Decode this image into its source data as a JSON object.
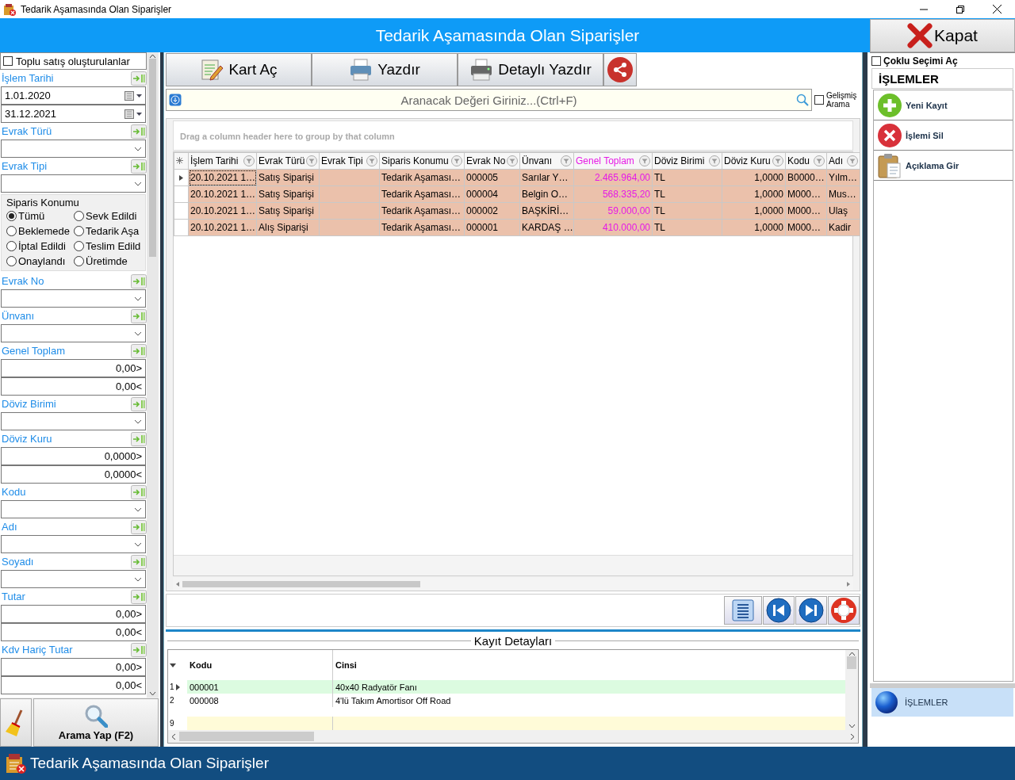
{
  "window": {
    "title": "Tedarik Aşamasında Olan Siparişler"
  },
  "header": {
    "title": "Tedarik Aşamasında Olan Siparişler",
    "close_button": "Kapat"
  },
  "filters": [
    {
      "kind": "check",
      "label": "Toplu satış oluşturulanlar",
      "checked": false
    },
    {
      "kind": "field",
      "label": "İşlem Tarihi",
      "inputs": [
        {
          "kind": "date",
          "value": "1.01.2020"
        },
        {
          "kind": "date",
          "value": "31.12.2021"
        }
      ]
    },
    {
      "kind": "field",
      "label": "Evrak Türü",
      "inputs": [
        {
          "kind": "combo"
        }
      ]
    },
    {
      "kind": "field",
      "label": "Evrak Tipi",
      "inputs": [
        {
          "kind": "combo"
        }
      ]
    },
    {
      "kind": "radios",
      "label": "Siparis Konumu",
      "options": [
        {
          "label": "Tümü",
          "selected": true
        },
        {
          "label": "Sevk Edildi",
          "selected": false
        },
        {
          "label": "Beklemede",
          "selected": false
        },
        {
          "label": "Tedarik Aşa",
          "selected": false
        },
        {
          "label": "İptal Edildi",
          "selected": false
        },
        {
          "label": "Teslim Edild",
          "selected": false
        },
        {
          "label": "Onaylandı",
          "selected": false
        },
        {
          "label": "Üretimde",
          "selected": false
        }
      ]
    },
    {
      "kind": "field",
      "label": "Evrak No",
      "inputs": [
        {
          "kind": "combo"
        }
      ]
    },
    {
      "kind": "field",
      "label": "Ünvanı",
      "inputs": [
        {
          "kind": "combo"
        }
      ]
    },
    {
      "kind": "field",
      "label": "Genel Toplam",
      "inputs": [
        {
          "kind": "number",
          "value": "0,00>"
        },
        {
          "kind": "number",
          "value": "0,00<"
        }
      ]
    },
    {
      "kind": "field",
      "label": "Döviz Birimi",
      "inputs": [
        {
          "kind": "combo"
        }
      ]
    },
    {
      "kind": "field",
      "label": "Döviz Kuru",
      "inputs": [
        {
          "kind": "number",
          "value": "0,0000>"
        },
        {
          "kind": "number",
          "value": "0,0000<"
        }
      ]
    },
    {
      "kind": "field",
      "label": "Kodu",
      "inputs": [
        {
          "kind": "combo"
        }
      ]
    },
    {
      "kind": "field",
      "label": "Adı",
      "inputs": [
        {
          "kind": "combo"
        }
      ]
    },
    {
      "kind": "field",
      "label": "Soyadı",
      "inputs": [
        {
          "kind": "combo"
        }
      ]
    },
    {
      "kind": "field",
      "label": "Tutar",
      "inputs": [
        {
          "kind": "number",
          "value": "0,00>"
        },
        {
          "kind": "number",
          "value": "0,00<"
        }
      ]
    },
    {
      "kind": "field",
      "label": "Kdv Hariç Tutar",
      "inputs": [
        {
          "kind": "number",
          "value": "0,00>"
        },
        {
          "kind": "number",
          "value": "0,00<"
        }
      ]
    }
  ],
  "filter_actions": {
    "search_button": "Arama Yap (F2)"
  },
  "toolbar": [
    {
      "kind": "edit",
      "label": "Kart Aç"
    },
    {
      "kind": "print",
      "label": "Yazdır"
    },
    {
      "kind": "print_detail",
      "label": "Detaylı Yazdır"
    },
    {
      "kind": "share"
    }
  ],
  "search": {
    "placeholder": "Aranacak Değeri Giriniz...(Ctrl+F)",
    "advanced": {
      "label": "Gelişmiş Arama",
      "checked": false
    }
  },
  "grid": {
    "group_hint": "Drag a column header here to group by that column",
    "columns": [
      {
        "label": "İşlem Tarihi",
        "kind": "text"
      },
      {
        "label": "Evrak Türü",
        "kind": "text"
      },
      {
        "label": "Evrak Tipi",
        "kind": "text"
      },
      {
        "label": "Siparis Konumu",
        "kind": "text"
      },
      {
        "label": "Evrak No",
        "kind": "text"
      },
      {
        "label": "Ünvanı",
        "kind": "text"
      },
      {
        "label": "Genel Toplam",
        "kind": "total"
      },
      {
        "label": "Döviz Birimi",
        "kind": "text"
      },
      {
        "label": "Döviz Kuru",
        "kind": "number"
      },
      {
        "label": "Kodu",
        "kind": "text"
      },
      {
        "label": "Adı",
        "kind": "text"
      }
    ],
    "rows": [
      {
        "selected": true,
        "cells": [
          "20.10.2021 1…",
          "Satış Siparişi",
          "",
          "Tedarik Aşaması…",
          "000005",
          "Sarılar Y…",
          "2.465.964,00",
          "TL",
          "1,0000",
          "B0000…",
          "Yılm…"
        ]
      },
      {
        "selected": false,
        "cells": [
          "20.10.2021 1…",
          "Satış Siparişi",
          "",
          "Tedarik Aşaması…",
          "000004",
          "Belgin O…",
          "568.335,20",
          "TL",
          "1,0000",
          "M000…",
          "Mus…"
        ]
      },
      {
        "selected": false,
        "cells": [
          "20.10.2021 1…",
          "Satış Siparişi",
          "",
          "Tedarik Aşaması…",
          "000002",
          "BAŞKİRİ…",
          "59.000,00",
          "TL",
          "1,0000",
          "M000…",
          "Ulaş"
        ]
      },
      {
        "selected": false,
        "cells": [
          "20.10.2021 1…",
          "Alış Siparişi",
          "",
          "Tedarik Aşaması…",
          "000001",
          "KARDAŞ …",
          "410.000,00",
          "TL",
          "1,0000",
          "M000…",
          "Kadir"
        ]
      }
    ]
  },
  "navigator": [
    {
      "kind": "list"
    },
    {
      "kind": "first"
    },
    {
      "kind": "last"
    },
    {
      "kind": "help"
    }
  ],
  "details": {
    "title": "Kayıt Detayları",
    "columns": [
      "Kodu",
      "Cinsi"
    ],
    "rows": [
      {
        "number": "1",
        "selected": true,
        "cells": [
          "000001",
          "40x40 Radyatör Fanı"
        ]
      },
      {
        "number": "2",
        "selected": false,
        "cells": [
          "000008",
          "4'lü Takım Amortisor Off Road"
        ]
      }
    ],
    "new_row": {
      "number": "9"
    }
  },
  "actions": {
    "multi_select": {
      "label": "Çoklu Seçimi Aç",
      "checked": false
    },
    "title": "İŞLEMLER",
    "items": [
      {
        "kind": "add",
        "label": "Yeni Kayıt"
      },
      {
        "kind": "delete",
        "label": "İşlemi Sil"
      },
      {
        "kind": "note",
        "label": "Açıklama Gir"
      }
    ],
    "group_bar": {
      "label": "İŞLEMLER",
      "selected": true
    }
  },
  "status_bar": {
    "title": "Tedarik Aşamasında Olan Siparişler"
  }
}
